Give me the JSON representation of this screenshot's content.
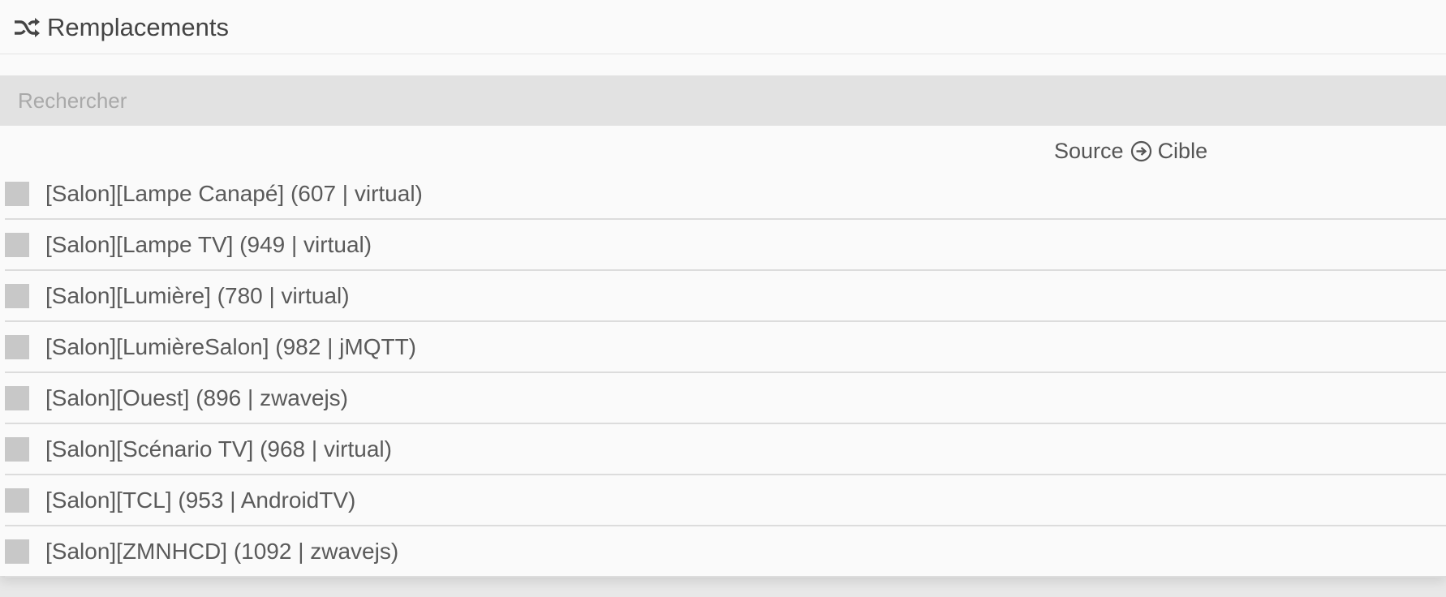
{
  "header": {
    "icon": "shuffle-icon",
    "title": "Remplacements"
  },
  "search": {
    "placeholder": "Rechercher",
    "value": ""
  },
  "columns": {
    "source": "Source",
    "arrow_icon": "circle-arrow-right-icon",
    "target": "Cible"
  },
  "rows": [
    {
      "label": "[Salon][Lampe Canapé] (607 | virtual)",
      "checked": false
    },
    {
      "label": "[Salon][Lampe TV] (949 | virtual)",
      "checked": false
    },
    {
      "label": "[Salon][Lumière] (780 | virtual)",
      "checked": false
    },
    {
      "label": "[Salon][LumièreSalon] (982 | jMQTT)",
      "checked": false
    },
    {
      "label": "[Salon][Ouest] (896 | zwavejs)",
      "checked": false
    },
    {
      "label": "[Salon][Scénario TV] (968 | virtual)",
      "checked": false
    },
    {
      "label": "[Salon][TCL] (953 | AndroidTV)",
      "checked": false
    },
    {
      "label": "[Salon][ZMNHCD] (1092 | zwavejs)",
      "checked": false
    }
  ],
  "colors": {
    "panel_bg": "#fafafa",
    "search_bg": "#e2e2e2",
    "checkbox": "#c8c8c8",
    "text": "#555555"
  }
}
